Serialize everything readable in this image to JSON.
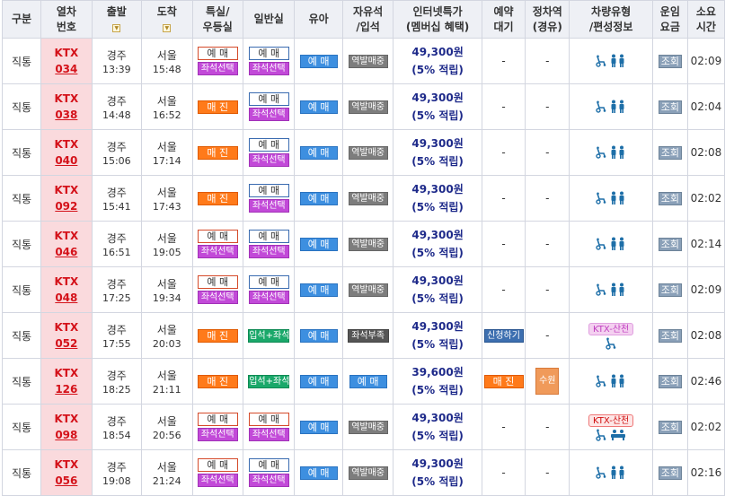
{
  "headers": {
    "gubun": "구분",
    "train_no_1": "열차",
    "train_no_2": "번호",
    "depart": "출발",
    "arrive": "도착",
    "special_1": "특실/",
    "special_2": "우등실",
    "general": "일반실",
    "kid": "유아",
    "free_1": "자유석",
    "free_2": "/입석",
    "internet_1": "인터넷특가",
    "internet_2": "(멤버십 혜택)",
    "reserve_1": "예약",
    "reserve_2": "대기",
    "stop_1": "정차역",
    "stop_2": "(경유)",
    "vehicle_1": "차량유형",
    "vehicle_2": "/편성정보",
    "fare_1": "운임",
    "fare_2": "요금",
    "dur_1": "소요",
    "dur_2": "시간",
    "sort_icon": "▼"
  },
  "labels": {
    "book": "예 매",
    "seat_select": "좌석선택",
    "sold_out": "매 진",
    "kid": "예 매",
    "free_sale": "역발매중",
    "standing_seat": "입석+좌석",
    "seat_lack": "좌석부족",
    "apply": "신청하기",
    "query": "조회",
    "dash": "-",
    "discount": "(5% 적립)",
    "ktx_sancheon": "KTX-산천"
  },
  "rows": [
    {
      "type": "직통",
      "train": "KTX",
      "no": "034",
      "from": "경주",
      "dep": "13:39",
      "to": "서울",
      "arr": "15:48",
      "special": "book",
      "general": "book",
      "free": "free_sale",
      "price": "49,300원",
      "reserve": "dash",
      "stop": "dash",
      "vehicle": "standard",
      "dur": "02:09"
    },
    {
      "type": "직통",
      "train": "KTX",
      "no": "038",
      "from": "경주",
      "dep": "14:48",
      "to": "서울",
      "arr": "16:52",
      "special": "sold",
      "general": "book",
      "free": "free_sale",
      "price": "49,300원",
      "reserve": "dash",
      "stop": "dash",
      "vehicle": "standard",
      "dur": "02:04"
    },
    {
      "type": "직통",
      "train": "KTX",
      "no": "040",
      "from": "경주",
      "dep": "15:06",
      "to": "서울",
      "arr": "17:14",
      "special": "sold",
      "general": "book",
      "free": "free_sale",
      "price": "49,300원",
      "reserve": "dash",
      "stop": "dash",
      "vehicle": "standard",
      "dur": "02:08"
    },
    {
      "type": "직통",
      "train": "KTX",
      "no": "092",
      "from": "경주",
      "dep": "15:41",
      "to": "서울",
      "arr": "17:43",
      "special": "sold",
      "general": "book",
      "free": "free_sale",
      "price": "49,300원",
      "reserve": "dash",
      "stop": "dash",
      "vehicle": "standard",
      "dur": "02:02"
    },
    {
      "type": "직통",
      "train": "KTX",
      "no": "046",
      "from": "경주",
      "dep": "16:51",
      "to": "서울",
      "arr": "19:05",
      "special": "book",
      "general": "book",
      "free": "free_sale",
      "price": "49,300원",
      "reserve": "dash",
      "stop": "dash",
      "vehicle": "standard",
      "dur": "02:14"
    },
    {
      "type": "직통",
      "train": "KTX",
      "no": "048",
      "from": "경주",
      "dep": "17:25",
      "to": "서울",
      "arr": "19:34",
      "special": "book",
      "general": "book",
      "free": "free_sale",
      "price": "49,300원",
      "reserve": "dash",
      "stop": "dash",
      "vehicle": "standard",
      "dur": "02:09"
    },
    {
      "type": "직통",
      "train": "KTX",
      "no": "052",
      "from": "경주",
      "dep": "17:55",
      "to": "서울",
      "arr": "20:03",
      "special": "sold",
      "general": "standing",
      "free": "seat_lack",
      "price": "49,300원",
      "reserve": "apply",
      "stop": "dash",
      "vehicle": "sancheon_pink",
      "dur": "02:08"
    },
    {
      "type": "직통",
      "train": "KTX",
      "no": "126",
      "from": "경주",
      "dep": "18:25",
      "to": "서울",
      "arr": "21:11",
      "special": "sold",
      "general": "standing",
      "free": "kid_book",
      "price": "39,600원",
      "reserve": "sold",
      "stop": "수원",
      "vehicle": "standard",
      "dur": "02:46"
    },
    {
      "type": "직통",
      "train": "KTX",
      "no": "098",
      "from": "경주",
      "dep": "18:54",
      "to": "서울",
      "arr": "20:56",
      "special": "book",
      "general": "book_red",
      "free": "free_sale",
      "price": "49,300원",
      "reserve": "dash",
      "stop": "dash",
      "vehicle": "sancheon_red",
      "dur": "02:02"
    },
    {
      "type": "직통",
      "train": "KTX",
      "no": "056",
      "from": "경주",
      "dep": "19:08",
      "to": "서울",
      "arr": "21:24",
      "special": "book",
      "general": "book",
      "free": "free_sale",
      "price": "49,300원",
      "reserve": "dash",
      "stop": "dash",
      "vehicle": "standard",
      "dur": "02:16"
    }
  ]
}
